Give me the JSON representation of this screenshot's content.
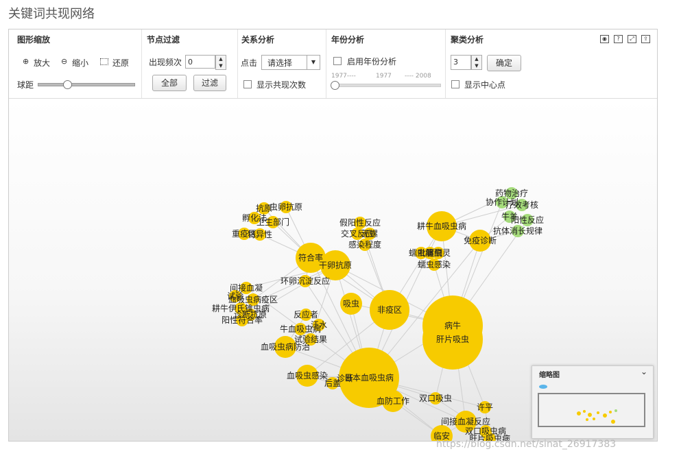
{
  "page_title": "关键词共现网络",
  "toolbar": {
    "zoom": {
      "title": "图形缩放",
      "zoom_in": "放大",
      "zoom_out": "缩小",
      "reset": "还原",
      "ball_distance": "球距",
      "ball_distance_level": 0.3
    },
    "filter": {
      "title": "节点过滤",
      "freq_label": "出现频次",
      "freq_value": "0",
      "all_button": "全部",
      "filter_button": "过滤"
    },
    "relation": {
      "title": "关系分析",
      "click_label": "点击",
      "select_value": "请选择",
      "show_count": "显示共现次数"
    },
    "year": {
      "title": "年份分析",
      "enable": "启用年份分析",
      "range_start": "1977----",
      "range_mid": "1977",
      "range_end": "---- 2008"
    },
    "cluster": {
      "title": "聚类分析",
      "value": "3",
      "confirm_button": "确定",
      "show_center": "显示中心点"
    },
    "icons": [
      "camera-icon",
      "help-icon",
      "fullscreen-icon",
      "export-icon"
    ]
  },
  "graph": {
    "colors": {
      "main": "#F7CB00",
      "cluster": "#A6DC7C",
      "edge": "#CFCFCF"
    },
    "nodes": [
      {
        "label": "抗原",
        "freq": 1
      },
      {
        "label": "孵化法",
        "freq": 1
      },
      {
        "label": "卫生部门",
        "freq": 1
      },
      {
        "label": "重疫区",
        "freq": 1
      },
      {
        "label": "特异性",
        "freq": 1
      },
      {
        "label": "虫卵抗原",
        "freq": 1
      },
      {
        "label": "符合率",
        "freq": 3
      },
      {
        "label": "干卵抗原",
        "freq": 3
      },
      {
        "label": "环卵沉淀反应",
        "freq": 1
      },
      {
        "label": "间接血凝",
        "freq": 1
      },
      {
        "label": "试验",
        "freq": 1
      },
      {
        "label": "血吸虫病疫区",
        "freq": 1
      },
      {
        "label": "耕牛伊氏锥虫病",
        "freq": 1
      },
      {
        "label": "诊断抗原",
        "freq": 1
      },
      {
        "label": "阳性符合率",
        "freq": 1
      },
      {
        "label": "假阳性反应",
        "freq": 1
      },
      {
        "label": "交叉反应",
        "freq": 1
      },
      {
        "label": "无螺",
        "freq": 1
      },
      {
        "label": "感染程度",
        "freq": 1
      },
      {
        "label": "吸虫",
        "freq": 2
      },
      {
        "label": "非疫区",
        "freq": 5
      },
      {
        "label": "耕牛血吸虫病",
        "freq": 3
      },
      {
        "label": "病牛",
        "freq": 10
      },
      {
        "label": "肝片吸虫",
        "freq": 10
      },
      {
        "label": "免疫诊断",
        "freq": 2
      },
      {
        "label": "蠕虫病",
        "freq": 1
      },
      {
        "label": "吡喹酮",
        "freq": 1
      },
      {
        "label": "驱虫灵",
        "freq": 1
      },
      {
        "label": "蠕虫感染",
        "freq": 1
      },
      {
        "label": "药物治疗",
        "freq": 1
      },
      {
        "label": "协作计划",
        "freq": 1
      },
      {
        "label": "疗效考核",
        "freq": 1
      },
      {
        "label": "牛羊",
        "freq": 1
      },
      {
        "label": "阳性反应",
        "freq": 1
      },
      {
        "label": "抗体消长规律",
        "freq": 1
      },
      {
        "label": "反应者",
        "freq": 1
      },
      {
        "label": "牛血吸虫病",
        "freq": 1
      },
      {
        "label": "汗水",
        "freq": 1
      },
      {
        "label": "试验结果",
        "freq": 1
      },
      {
        "label": "血吸虫病防治",
        "freq": 2
      },
      {
        "label": "血吸虫感染",
        "freq": 2
      },
      {
        "label": "后盖",
        "freq": 1
      },
      {
        "label": "诊断",
        "freq": 1
      },
      {
        "label": "日本血吸虫病",
        "freq": 12
      },
      {
        "label": "血防工作",
        "freq": 2
      },
      {
        "label": "双口吸虫",
        "freq": 1
      },
      {
        "label": "许平",
        "freq": 1
      },
      {
        "label": "间接血凝反应",
        "freq": 2
      },
      {
        "label": "双口吸虫病",
        "freq": 1
      },
      {
        "label": "临安",
        "freq": 2
      },
      {
        "label": "肝片吸虫病",
        "freq": 1
      }
    ]
  },
  "minimap": {
    "title": "缩略图",
    "collapse_icon": "chevron-down-icon"
  },
  "watermark": "https://blog.csdn.net/sinat_26917383"
}
